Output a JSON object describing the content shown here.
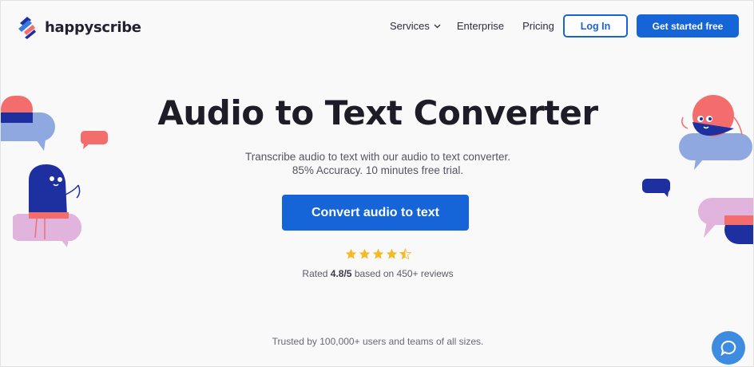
{
  "brand": {
    "name": "happyscribe",
    "logo_icon": "happyscribe-logo-icon"
  },
  "nav": {
    "services": "Services",
    "enterprise": "Enterprise",
    "pricing": "Pricing",
    "login": "Log In",
    "get_started": "Get started free"
  },
  "hero": {
    "title": "Audio to Text Converter",
    "subtitle_line1": "Transcribe audio to text with our audio to text converter.",
    "subtitle_line2": "85% Accuracy. 10 minutes free trial.",
    "cta": "Convert audio to text"
  },
  "rating": {
    "stars": 4.5,
    "prefix": "Rated ",
    "score": "4.8/5",
    "suffix": " based on 450+ reviews"
  },
  "trusted": "Trusted by 100,000+ users and teams of all sizes.",
  "colors": {
    "primary": "#1565d8",
    "star": "#f5b921",
    "bubble_blue": "#8fa8e0",
    "bubble_coral": "#f36d6d",
    "bubble_pink": "#e0b4dc",
    "navy": "#1e2fa0"
  },
  "icons": {
    "chat": "chat-bubble-icon",
    "chevron": "chevron-down-icon"
  }
}
